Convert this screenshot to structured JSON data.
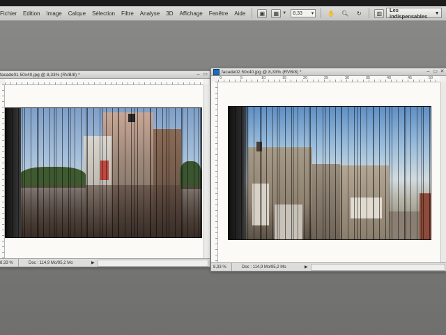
{
  "menu": [
    "Fichier",
    "Edition",
    "Image",
    "Calque",
    "Sélection",
    "Filtre",
    "Analyse",
    "3D",
    "Affichage",
    "Fenêtre",
    "Aide"
  ],
  "toolbar": {
    "zoom_value": "8,33",
    "workspace": "Les indispensables",
    "icons": [
      "bridge-icon",
      "grid-icon",
      "zoom-menu-icon",
      "hand-icon",
      "magnifier-icon",
      "rotate-icon",
      "arrange-icon",
      "screen-mode-icon"
    ]
  },
  "doc_left": {
    "title": "facade01 50x40.jpg @ 8,33% (RVB/8) *",
    "status_zoom": "8,33 %",
    "status_doc": "Doc : 114,9 Mo/95,2 Mo"
  },
  "doc_right": {
    "title": "facade02 50x40.jpg @ 8,33% (RVB/8) *",
    "status_zoom": "8,33 %",
    "status_doc": "Doc : 114,9 Mo/95,2 Mo",
    "ruler_labels": [
      "0",
      "5",
      "10",
      "15",
      "20",
      "25",
      "30",
      "35",
      "40",
      "45",
      "50"
    ]
  },
  "colors": {
    "menubar": "#d4d4d2",
    "doc_bg": "#f0efeb",
    "ps_icon": "#1f6bb8"
  }
}
